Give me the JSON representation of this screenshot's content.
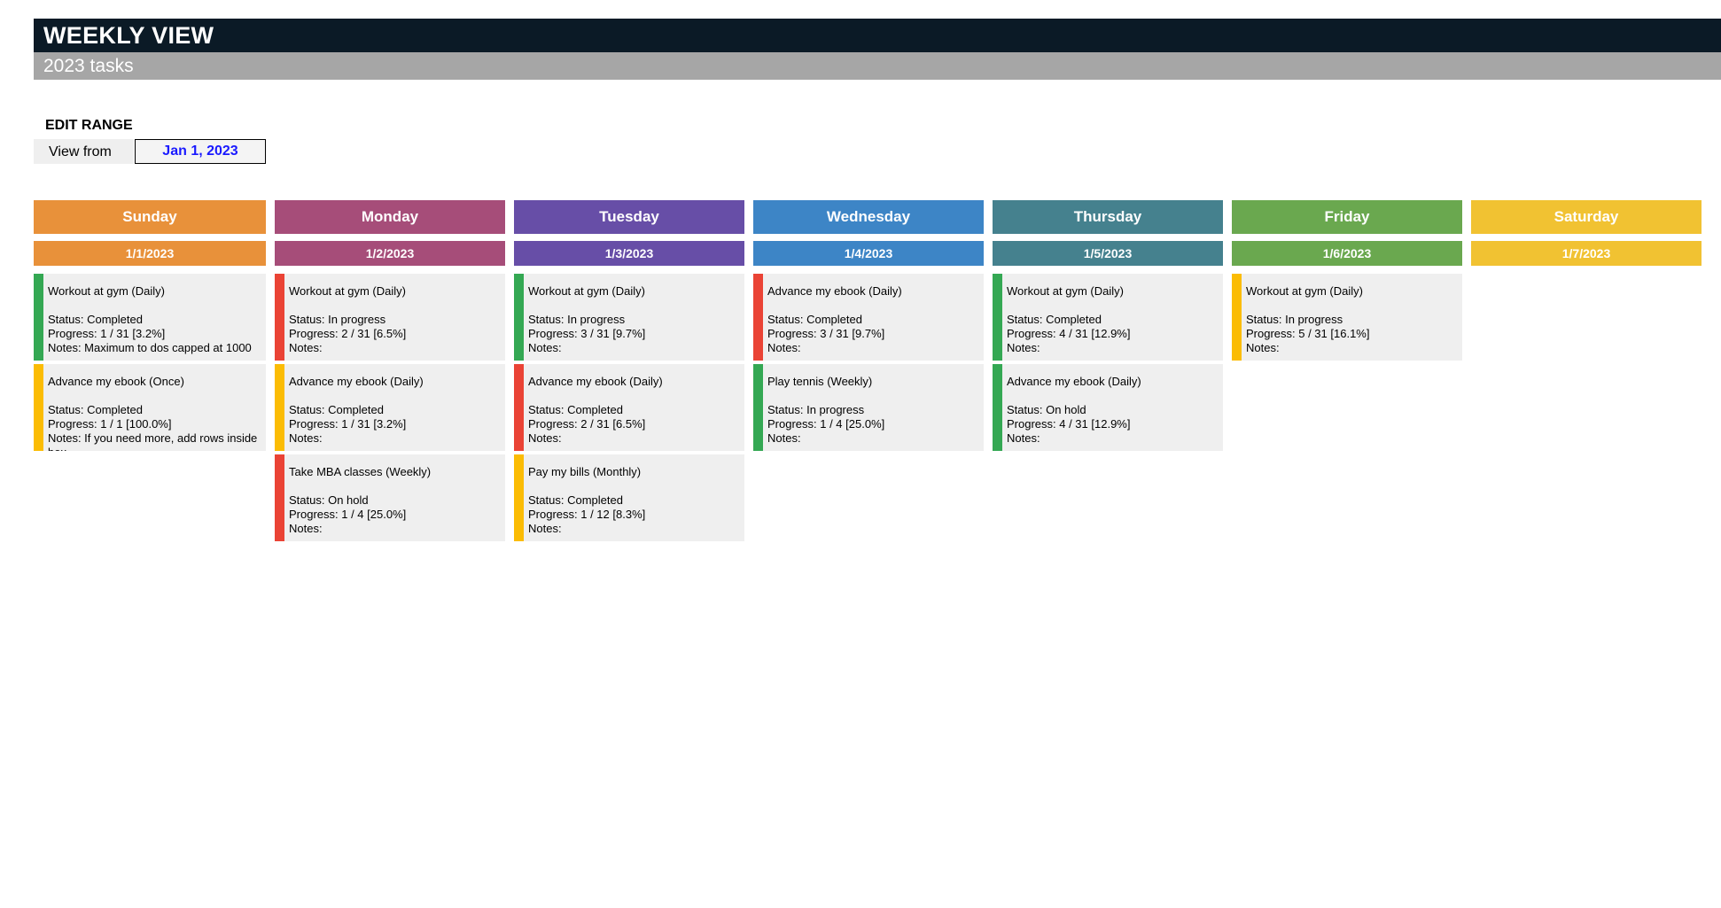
{
  "header": {
    "title": "WEEKLY VIEW",
    "subtitle": "2023 tasks"
  },
  "range": {
    "label": "EDIT RANGE",
    "view_from_label": "View from",
    "view_from_value": "Jan 1, 2023"
  },
  "status_colors": {
    "green": "#34a853",
    "red": "#ea4335",
    "yellow": "#fbbc04"
  },
  "days": [
    {
      "name": "Sunday",
      "date": "1/1/2023",
      "color": "#e8913a",
      "tasks": [
        {
          "title": "Workout at gym (Daily)",
          "status": "Status: Completed",
          "progress": "Progress: 1 / 31  [3.2%]",
          "notes": "Notes: Maximum to dos capped at 1000",
          "stripe": "#34a853"
        },
        {
          "title": "Advance my ebook (Once)",
          "status": "Status: Completed",
          "progress": "Progress: 1 / 1  [100.0%]",
          "notes": "Notes: If you need more, add rows inside box",
          "stripe": "#fbbc04"
        }
      ]
    },
    {
      "name": "Monday",
      "date": "1/2/2023",
      "color": "#a64d79",
      "tasks": [
        {
          "title": "Workout at gym (Daily)",
          "status": "Status: In progress",
          "progress": "Progress: 2 / 31  [6.5%]",
          "notes": "Notes:",
          "stripe": "#ea4335"
        },
        {
          "title": "Advance my ebook (Daily)",
          "status": "Status: Completed",
          "progress": "Progress: 1 / 31  [3.2%]",
          "notes": "Notes:",
          "stripe": "#fbbc04"
        },
        {
          "title": "Take MBA classes (Weekly)",
          "status": "Status: On hold",
          "progress": "Progress: 1 / 4  [25.0%]",
          "notes": "Notes:",
          "stripe": "#ea4335"
        }
      ]
    },
    {
      "name": "Tuesday",
      "date": "1/3/2023",
      "color": "#674ea7",
      "tasks": [
        {
          "title": "Workout at gym (Daily)",
          "status": "Status: In progress",
          "progress": "Progress: 3 / 31  [9.7%]",
          "notes": "Notes:",
          "stripe": "#34a853"
        },
        {
          "title": "Advance my ebook (Daily)",
          "status": "Status: Completed",
          "progress": "Progress: 2 / 31  [6.5%]",
          "notes": "Notes:",
          "stripe": "#ea4335"
        },
        {
          "title": "Pay my bills (Monthly)",
          "status": "Status: Completed",
          "progress": "Progress: 1 / 12  [8.3%]",
          "notes": "Notes:",
          "stripe": "#fbbc04"
        }
      ]
    },
    {
      "name": "Wednesday",
      "date": "1/4/2023",
      "color": "#3d85c6",
      "tasks": [
        {
          "title": "Advance my ebook (Daily)",
          "status": "Status: Completed",
          "progress": "Progress: 3 / 31  [9.7%]",
          "notes": "Notes:",
          "stripe": "#ea4335"
        },
        {
          "title": "Play tennis (Weekly)",
          "status": "Status: In progress",
          "progress": "Progress: 1 / 4  [25.0%]",
          "notes": "Notes:",
          "stripe": "#34a853"
        }
      ]
    },
    {
      "name": "Thursday",
      "date": "1/5/2023",
      "color": "#45818e",
      "tasks": [
        {
          "title": "Workout at gym (Daily)",
          "status": "Status: Completed",
          "progress": "Progress: 4 / 31  [12.9%]",
          "notes": "Notes:",
          "stripe": "#34a853"
        },
        {
          "title": "Advance my ebook (Daily)",
          "status": "Status: On hold",
          "progress": "Progress: 4 / 31  [12.9%]",
          "notes": "Notes:",
          "stripe": "#34a853"
        }
      ]
    },
    {
      "name": "Friday",
      "date": "1/6/2023",
      "color": "#6aa84f",
      "tasks": [
        {
          "title": "Workout at gym (Daily)",
          "status": "Status: In progress",
          "progress": "Progress: 5 / 31  [16.1%]",
          "notes": "Notes:",
          "stripe": "#fbbc04"
        }
      ]
    },
    {
      "name": "Saturday",
      "date": "1/7/2023",
      "color": "#f1c232",
      "tasks": []
    }
  ]
}
